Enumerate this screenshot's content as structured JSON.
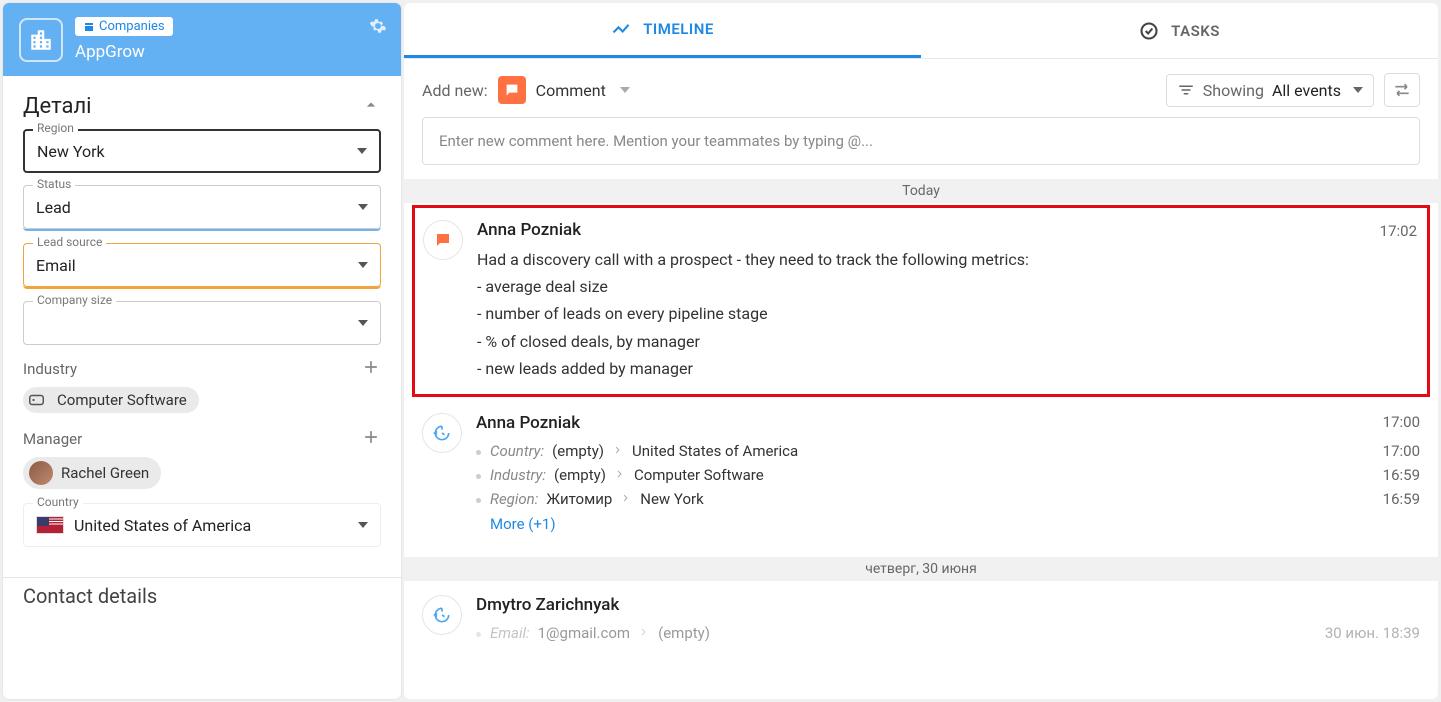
{
  "header": {
    "tag_label": "Companies",
    "company_name": "AppGrow"
  },
  "details": {
    "title": "Деталі",
    "region": {
      "label": "Region",
      "value": "New York"
    },
    "status": {
      "label": "Status",
      "value": "Lead"
    },
    "lead_source": {
      "label": "Lead source",
      "value": "Email"
    },
    "company_size": {
      "label": "Company size",
      "value": ""
    },
    "industry": {
      "label": "Industry",
      "chip": "Computer Software"
    },
    "manager": {
      "label": "Manager",
      "chip": "Rachel Green"
    },
    "country": {
      "label": "Country",
      "value": "United States of America"
    },
    "contact_details_title": "Contact details"
  },
  "tabs": {
    "timeline": "TIMELINE",
    "tasks": "TASKS"
  },
  "toolbar": {
    "add_new": "Add new:",
    "type": "Comment",
    "showing": "Showing",
    "filter_value": "All events"
  },
  "comment_placeholder": "Enter new comment here. Mention your teammates by typing @...",
  "separators": {
    "today": "Today",
    "prev": "четверг, 30 июня"
  },
  "entry1": {
    "author": "Anna Pozniak",
    "time": "17:02",
    "lines": [
      "Had a discovery call with a prospect - they need to track the following metrics:",
      "- average deal size",
      "- number of leads on every pipeline stage",
      "- % of closed deals, by manager",
      "- new leads added by manager"
    ]
  },
  "entry2": {
    "author": "Anna Pozniak",
    "time": "17:00",
    "changes": [
      {
        "field": "Country:",
        "from": "(empty)",
        "to": "United States of America",
        "time": "17:00"
      },
      {
        "field": "Industry:",
        "from": "(empty)",
        "to": "Computer Software",
        "time": "16:59"
      },
      {
        "field": "Region:",
        "from": "Житомир",
        "to": "New York",
        "time": "16:59"
      }
    ],
    "more": "More (+1)"
  },
  "entry3": {
    "author": "Dmytro Zarichnyak",
    "change": {
      "field": "Email:",
      "from": "1@gmail.com",
      "to": "(empty)",
      "time": "30 июн.   18:39"
    }
  }
}
